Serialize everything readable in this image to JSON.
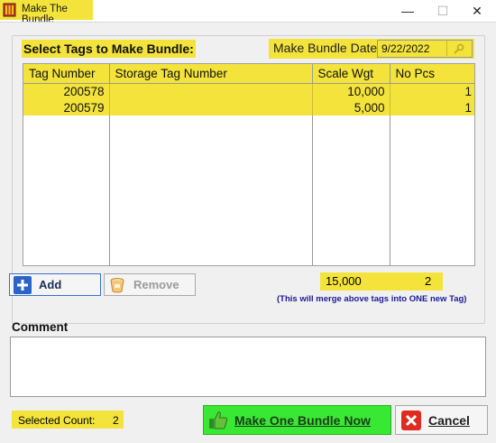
{
  "window": {
    "title": "Make The Bundle",
    "controls": {
      "minimize": "—",
      "maximize": "☐",
      "close": "✕"
    }
  },
  "panel": {
    "title": "Select Tags to Make Bundle:",
    "date_label": "Make Bundle Date:",
    "date_value": "9/22/2022"
  },
  "grid": {
    "columns": [
      "Tag Number",
      "Storage Tag Number",
      "Scale Wgt",
      "No Pcs"
    ],
    "rows": [
      {
        "tag_number": "200578",
        "storage_tag_number": "",
        "scale_wgt": "10,000",
        "no_pcs": "1"
      },
      {
        "tag_number": "200579",
        "storage_tag_number": "",
        "scale_wgt": "5,000",
        "no_pcs": "1"
      }
    ]
  },
  "totals": {
    "scale_wgt": "15,000",
    "no_pcs": "2"
  },
  "buttons": {
    "add": "Add",
    "remove": "Remove",
    "make_bundle": "Make One Bundle Now",
    "cancel": "Cancel"
  },
  "merge_note": "(This will merge above tags into ONE new Tag)",
  "comment": {
    "label": "Comment",
    "value": ""
  },
  "selected_count": {
    "label": "Selected Count:",
    "value": "2"
  },
  "colors": {
    "highlight": "#f3e33a",
    "make_button": "#39e832",
    "note_text": "#1a1a9a"
  },
  "icons": [
    "app-icon",
    "search-icon",
    "plus-icon",
    "bucket-icon",
    "thumbs-up-icon",
    "x-icon"
  ]
}
